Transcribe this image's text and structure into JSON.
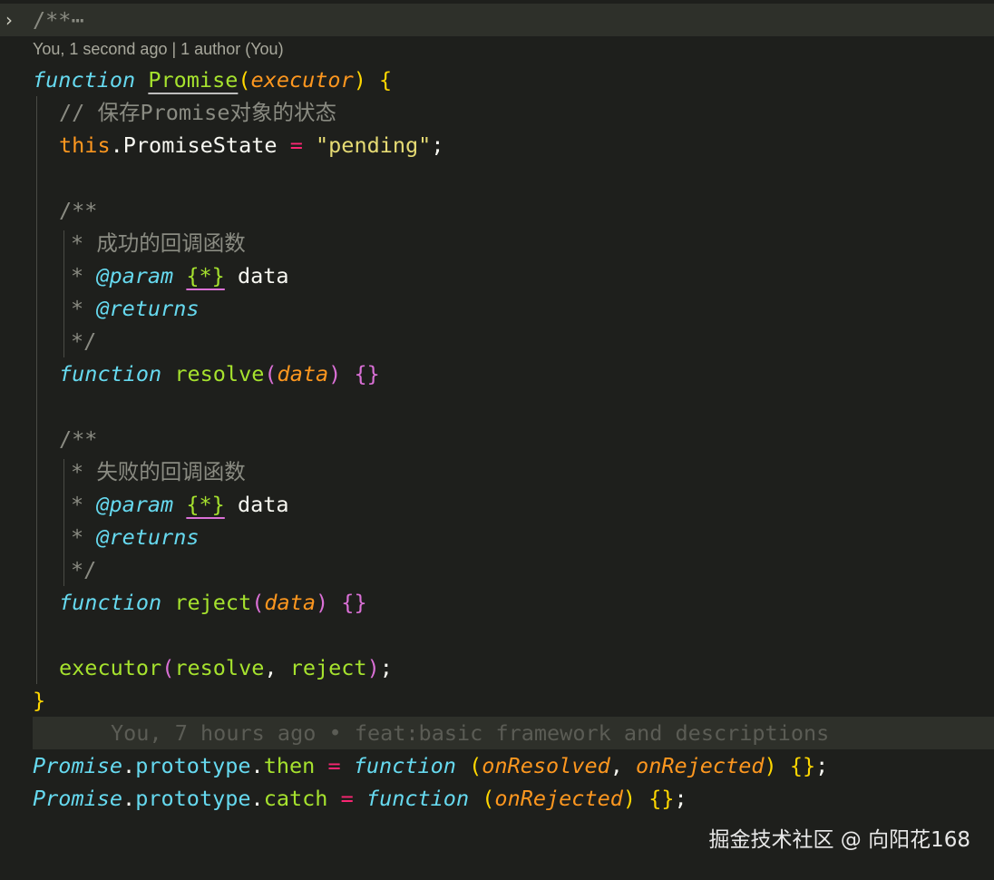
{
  "fold_comment": "/**",
  "fold_ellipsis": "⋯",
  "codelens": "You, 1 second ago | 1 author (You)",
  "code": {
    "kw_function": "function",
    "fn_promise": "Promise",
    "param_executor": "executor",
    "comment_state": "// 保存Promise对象的状态",
    "this": "this",
    "prop_state": "PromiseState",
    "assign": "=",
    "pending": "\"pending\"",
    "doc_open": "/**",
    "doc_star": "*",
    "doc_close": "*/",
    "doc_success": "成功的回调函数",
    "doc_fail": "失败的回调函数",
    "param_tag": "@param",
    "type_any": "{*}",
    "data": "data",
    "returns_tag": "@returns",
    "fn_resolve": "resolve",
    "fn_reject": "reject",
    "executor_call": "executor",
    "prototype": "prototype",
    "then": "then",
    "catch": "catch",
    "onResolved": "onResolved",
    "onRejected": "onRejected"
  },
  "blame": "You, 7 hours ago • feat:basic framework and descriptions",
  "watermark": "掘金技术社区 @ 向阳花168"
}
